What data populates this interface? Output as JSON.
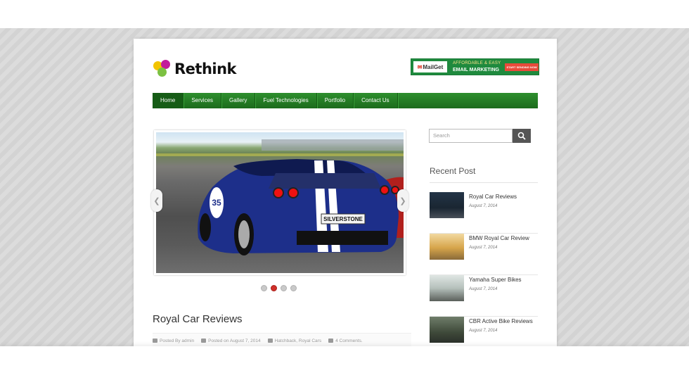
{
  "brand": {
    "name": "Rethink"
  },
  "ad": {
    "logo_text": "MailGet",
    "line1": "AFFORDABLE & EASY",
    "line2": "EMAIL MARKETING",
    "button": "START SENDING NOW"
  },
  "nav": {
    "items": [
      {
        "label": "Home",
        "active": true
      },
      {
        "label": "Services",
        "active": false
      },
      {
        "label": "Gallery",
        "active": false
      },
      {
        "label": "Fuel Technologies",
        "active": false
      },
      {
        "label": "Portfolio",
        "active": false
      },
      {
        "label": "Contact Us",
        "active": false
      }
    ]
  },
  "slider": {
    "plate_text": "SILVERSTONE",
    "car_number": "35",
    "dots": 4,
    "active_dot": 2
  },
  "post": {
    "title": "Royal Car Reviews",
    "author": "Posted By admin",
    "date": "Posted on August 7, 2014",
    "categories": "Hatchback, Royal Cars",
    "comments": "4 Comments."
  },
  "search": {
    "placeholder": "Search"
  },
  "recent": {
    "title": "Recent Post",
    "items": [
      {
        "name": "Royal Car Reviews",
        "date": "August 7, 2014"
      },
      {
        "name": "BMW Royal Car Review",
        "date": "August 7, 2014"
      },
      {
        "name": "Yamaha Super Bikes",
        "date": "August 7, 2014"
      },
      {
        "name": "CBR Active Bike Reviews",
        "date": "August 7, 2014"
      }
    ]
  },
  "colors": {
    "nav_green": "#2e8f2e",
    "accent_red": "#d0302a",
    "car_blue": "#1d2f8a"
  }
}
